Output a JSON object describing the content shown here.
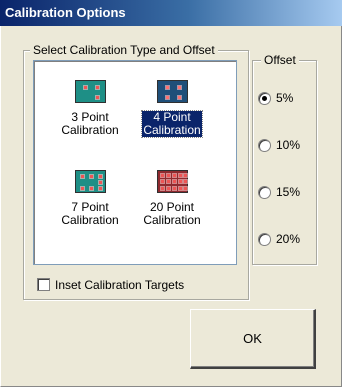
{
  "window": {
    "title": "Calibration Options"
  },
  "calibration_group": {
    "title": "Select Calibration Type and Offset",
    "options": [
      {
        "label_line1": "3 Point",
        "label_line2": "Calibration",
        "icon": "three-point-target-icon",
        "color": "#1e8f86",
        "selected": false
      },
      {
        "label_line1": "4 Point",
        "label_line2": "Calibration",
        "icon": "four-point-target-icon",
        "color": "#1f4f79",
        "selected": true
      },
      {
        "label_line1": "7 Point",
        "label_line2": "Calibration",
        "icon": "seven-point-target-icon",
        "color": "#1e8f86",
        "selected": false
      },
      {
        "label_line1": "20 Point",
        "label_line2": "Calibration",
        "icon": "twenty-point-target-icon",
        "color": "#8f2a2f",
        "selected": false
      }
    ]
  },
  "offset_group": {
    "title": "Offset",
    "options": [
      {
        "label": "5%",
        "checked": true
      },
      {
        "label": "10%",
        "checked": false
      },
      {
        "label": "15%",
        "checked": false
      },
      {
        "label": "20%",
        "checked": false
      }
    ]
  },
  "inset_checkbox": {
    "label": "Inset Calibration Targets",
    "checked": false
  },
  "ok_button": {
    "label": "OK"
  },
  "colors": {
    "title_bar": "#0a246a",
    "selection": "#0a246a",
    "background": "#ece9d8"
  }
}
